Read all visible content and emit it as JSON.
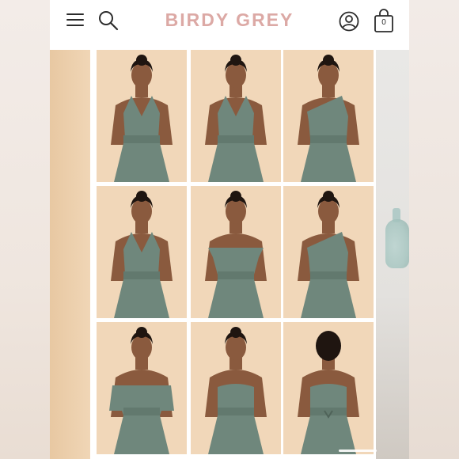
{
  "header": {
    "brand": "BIRDY GREY",
    "bag_count": "0",
    "icons": [
      "menu-icon",
      "search-icon",
      "account-icon",
      "shopping-bag-icon"
    ]
  },
  "colors": {
    "brand_pink": "#dca9a5",
    "backdrop_peach": "#f1d7b9",
    "dress_sage": "#6f877c"
  },
  "gallery": {
    "tiles": [
      {
        "id": "twist-halter"
      },
      {
        "id": "high-halter"
      },
      {
        "id": "one-shoulder"
      },
      {
        "id": "halter"
      },
      {
        "id": "off-shoulder"
      },
      {
        "id": "asymmetric-drape"
      },
      {
        "id": "cape-sleeve"
      },
      {
        "id": "strapless"
      },
      {
        "id": "back-tie"
      }
    ]
  }
}
